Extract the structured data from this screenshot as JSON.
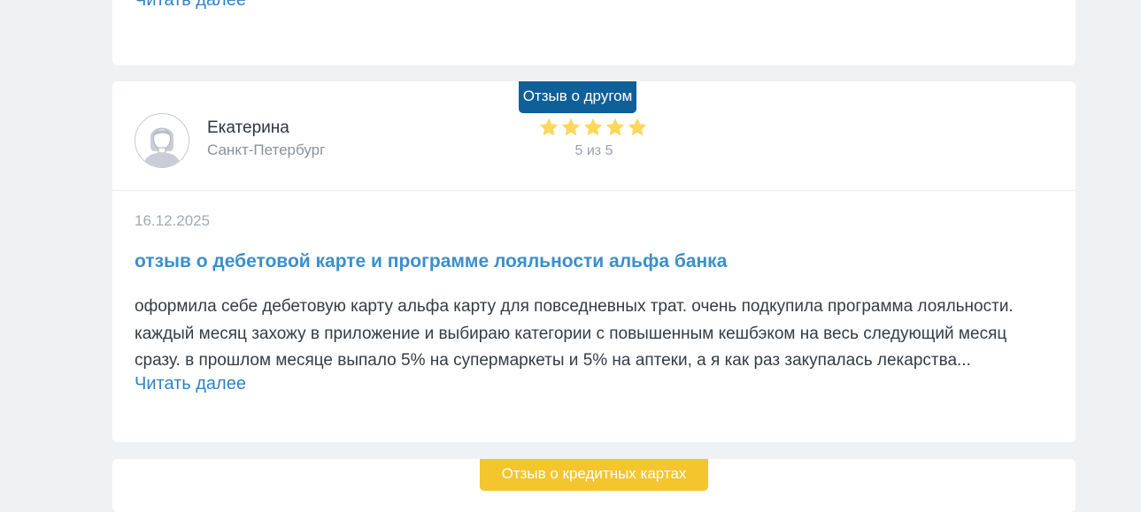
{
  "previous_review": {
    "read_more": "Читать далее"
  },
  "review": {
    "badge": "Отзыв о другом",
    "author": {
      "name": "Екатерина",
      "city": "Санкт-Петербург"
    },
    "rating": {
      "value": 5,
      "max": 5,
      "text": "5 из 5",
      "star_color": "#fdd65c"
    },
    "date": "16.12.2025",
    "title": "отзыв о дебетовой карте и программе лояльности альфа банка",
    "body_lines": [
      "оформила себе дебетовую карту альфа карту для повседневных трат. очень подкупила программа лояльности.",
      "каждый месяц захожу в приложение и выбираю категории с повышенным кешбэком на весь следующий месяц",
      "сразу. в прошлом месяце выпало 5% на супермаркеты и 5% на аптеки, а я как раз закупалась лекарства..."
    ],
    "read_more": "Читать далее"
  },
  "next_review": {
    "badge": "Отзыв о кредитных картах"
  },
  "colors": {
    "page_bg": "#eff2f5",
    "link": "#2f82c4",
    "title": "#3b8fcb",
    "badge_other": "#0f6099",
    "badge_credit": "#f4c52d"
  },
  "icons": {
    "avatar": "user-avatar-placeholder-icon",
    "star": "star-icon"
  }
}
